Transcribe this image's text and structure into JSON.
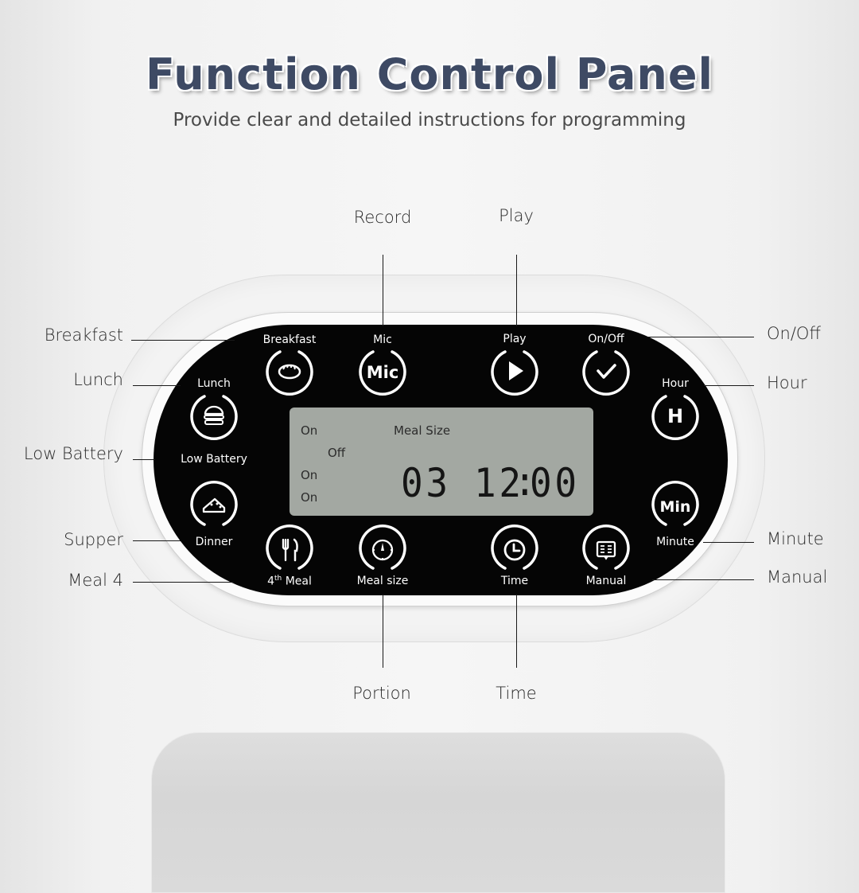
{
  "header": {
    "title": "Function Control Panel",
    "subtitle": "Provide clear and detailed instructions for programming"
  },
  "colors": {
    "title": "#3e4a64",
    "panel": "#050505",
    "lcd": "#a3a8a2",
    "button_stroke": "#ffffff"
  },
  "buttons": [
    {
      "id": "breakfast",
      "label": "Breakfast",
      "icon": "bread-icon"
    },
    {
      "id": "mic",
      "label": "Mic",
      "icon": "mic-text-icon",
      "glyph": "Mic"
    },
    {
      "id": "play",
      "label": "Play",
      "icon": "play-icon"
    },
    {
      "id": "onoff",
      "label": "On/Off",
      "icon": "check-icon"
    },
    {
      "id": "lunch",
      "label": "Lunch",
      "icon": "burger-icon"
    },
    {
      "id": "hour",
      "label": "Hour",
      "icon": "hour-icon",
      "glyph": "H"
    },
    {
      "id": "dinner",
      "label": "Dinner",
      "icon": "cake-slice-icon"
    },
    {
      "id": "minute",
      "label": "Minute",
      "icon": "min-text-icon",
      "glyph": "Min"
    },
    {
      "id": "meal4",
      "label_main": "Meal",
      "label_num": "4",
      "label_sup": "th",
      "icon": "fork-knife-icon"
    },
    {
      "id": "mealsize",
      "label": "Meal size",
      "icon": "dial-icon"
    },
    {
      "id": "time",
      "label": "Time",
      "icon": "clock-icon"
    },
    {
      "id": "manual",
      "label": "Manual",
      "icon": "book-icon"
    }
  ],
  "panel_status": {
    "low_battery": "Low Battery"
  },
  "lcd": {
    "on1": "On",
    "off": "Off",
    "on2": "On",
    "on3": "On",
    "meal_size_label": "Meal Size",
    "meal_size_value": "03",
    "time_hours": "12",
    "time_sep": ":",
    "time_minutes": "00"
  },
  "callouts": {
    "left": [
      "Breakfast",
      "Lunch",
      "Low Battery",
      "Supper",
      "Meal 4"
    ],
    "right": [
      "On/Off",
      "Hour",
      "Minute",
      "Manual"
    ],
    "top": [
      "Record",
      "Play"
    ],
    "bottom": [
      "Portion",
      "Time"
    ]
  }
}
